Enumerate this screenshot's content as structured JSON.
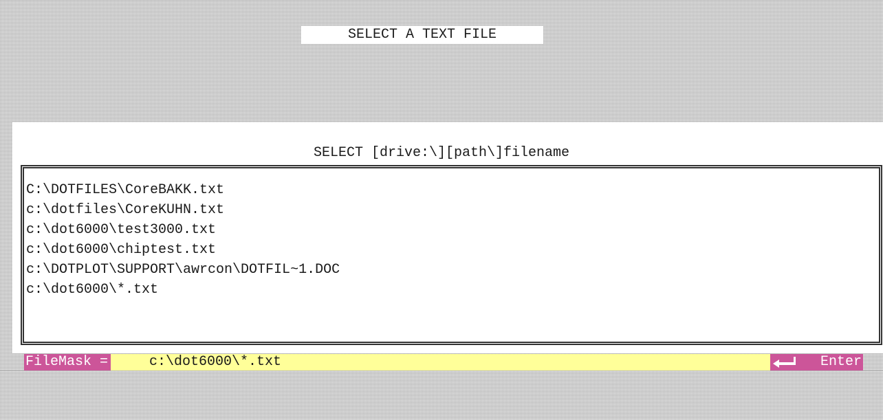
{
  "title": "SELECT A TEXT FILE",
  "prompt": "SELECT [drive:\\][path\\]filename",
  "files": [
    "C:\\DOTFILES\\CoreBAKK.txt",
    "c:\\dotfiles\\CoreKUHN.txt",
    "c:\\dot6000\\test3000.txt",
    "c:\\dot6000\\chiptest.txt",
    "c:\\DOTPLOT\\SUPPORT\\awrcon\\DOTFIL~1.DOC",
    "c:\\dot6000\\*.txt"
  ],
  "status_bar": {
    "filemask_label": "FileMask =",
    "filemask_value": "c:\\dot6000\\*.txt",
    "enter_icon": "enter-arrow-icon",
    "enter_label": "Enter"
  },
  "colors": {
    "label_bg": "#cc5599",
    "value_bg": "#ffff99",
    "panel_bg": "#ffffff"
  }
}
